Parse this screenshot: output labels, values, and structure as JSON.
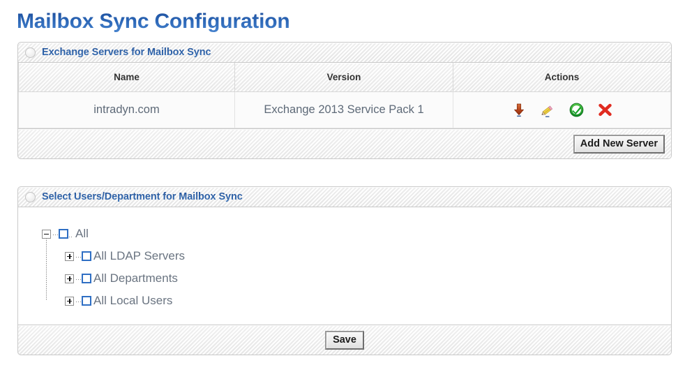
{
  "page": {
    "title": "Mailbox Sync Configuration"
  },
  "servers_panel": {
    "header_title": "Exchange Servers for Mailbox Sync",
    "toggle_icon": "circle-toggle-icon",
    "columns": [
      "Name",
      "Version",
      "Actions"
    ],
    "rows": [
      {
        "name": "intradyn.com",
        "version": "Exchange 2013 Service Pack 1",
        "actions": [
          {
            "icon": "download-arrow-icon",
            "label": "Download",
            "color": "#b5441a"
          },
          {
            "icon": "pencil-edit-icon",
            "label": "Edit",
            "color": "#e8c33a"
          },
          {
            "icon": "check-circle-icon",
            "label": "Verify",
            "color": "#1f9c2e"
          },
          {
            "icon": "red-x-delete-icon",
            "label": "Delete",
            "color": "#e02b20"
          }
        ]
      }
    ],
    "add_button_label": "Add New Server"
  },
  "users_panel": {
    "header_title": "Select Users/Department for Mailbox Sync",
    "toggle_icon": "circle-toggle-icon",
    "tree": {
      "root": {
        "label": "All",
        "expander": "minus",
        "checked": false
      },
      "children": [
        {
          "label": "All LDAP Servers",
          "expander": "plus",
          "checked": false
        },
        {
          "label": "All Departments",
          "expander": "plus",
          "checked": false
        },
        {
          "label": "All Local Users",
          "expander": "plus",
          "checked": false
        }
      ]
    },
    "save_button_label": "Save"
  },
  "colors": {
    "title_blue": "#2c63b0",
    "panel_title_blue": "#2d5d9e",
    "cell_text": "#5e6a78",
    "checkbox_blue": "#2f6fc4"
  }
}
